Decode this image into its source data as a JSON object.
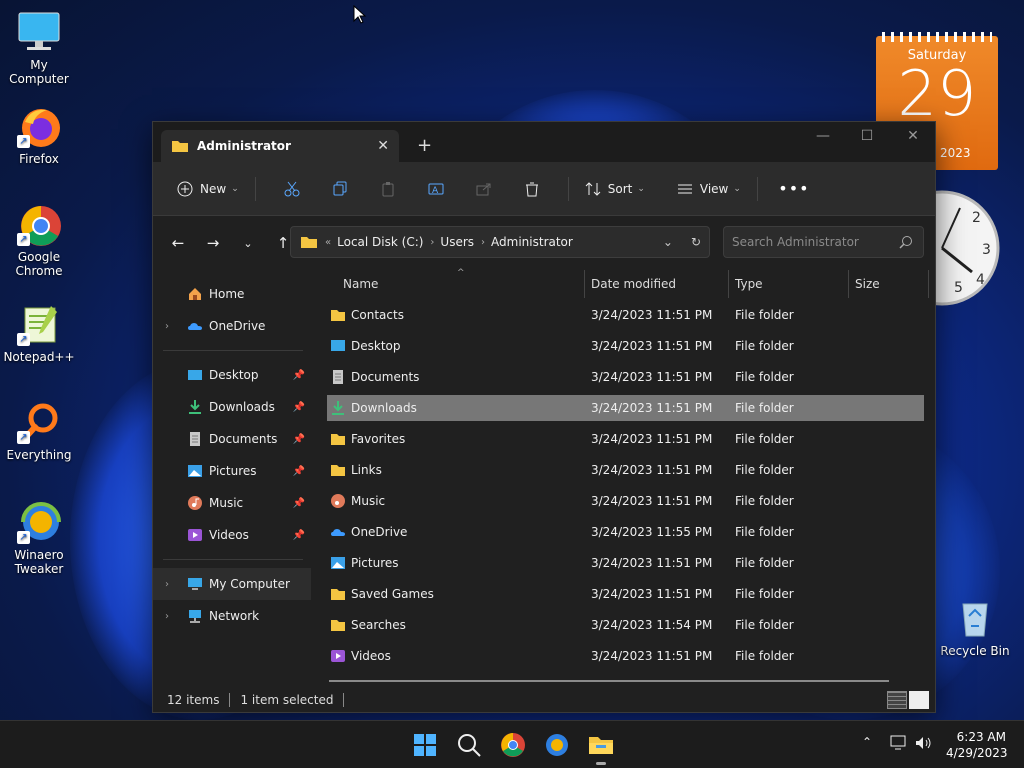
{
  "desktop": {
    "icons": [
      {
        "label": "My Computer"
      },
      {
        "label": "Firefox"
      },
      {
        "label": "Google Chrome"
      },
      {
        "label": "Notepad++"
      },
      {
        "label": "Everything"
      },
      {
        "label": "Winaero Tweaker"
      },
      {
        "label": "Recycle Bin"
      }
    ],
    "calendar": {
      "weekday": "Saturday",
      "day": "29",
      "year": "2023"
    }
  },
  "window": {
    "tab_title": "Administrator",
    "toolbar": {
      "new_label": "New",
      "sort_label": "Sort",
      "view_label": "View"
    },
    "address": {
      "crumbs": [
        "Local Disk (C:)",
        "Users",
        "Administrator"
      ]
    },
    "search": {
      "placeholder": "Search Administrator"
    },
    "sidebar": {
      "top": [
        {
          "label": "Home"
        },
        {
          "label": "OneDrive"
        }
      ],
      "quick": [
        {
          "label": "Desktop"
        },
        {
          "label": "Downloads"
        },
        {
          "label": "Documents"
        },
        {
          "label": "Pictures"
        },
        {
          "label": "Music"
        },
        {
          "label": "Videos"
        }
      ],
      "bottom": [
        {
          "label": "My Computer"
        },
        {
          "label": "Network"
        }
      ]
    },
    "columns": {
      "name": "Name",
      "date": "Date modified",
      "type": "Type",
      "size": "Size"
    },
    "rows": [
      {
        "name": "Contacts",
        "date": "3/24/2023 11:51 PM",
        "type": "File folder"
      },
      {
        "name": "Desktop",
        "date": "3/24/2023 11:51 PM",
        "type": "File folder"
      },
      {
        "name": "Documents",
        "date": "3/24/2023 11:51 PM",
        "type": "File folder"
      },
      {
        "name": "Downloads",
        "date": "3/24/2023 11:51 PM",
        "type": "File folder"
      },
      {
        "name": "Favorites",
        "date": "3/24/2023 11:51 PM",
        "type": "File folder"
      },
      {
        "name": "Links",
        "date": "3/24/2023 11:51 PM",
        "type": "File folder"
      },
      {
        "name": "Music",
        "date": "3/24/2023 11:51 PM",
        "type": "File folder"
      },
      {
        "name": "OneDrive",
        "date": "3/24/2023 11:55 PM",
        "type": "File folder"
      },
      {
        "name": "Pictures",
        "date": "3/24/2023 11:51 PM",
        "type": "File folder"
      },
      {
        "name": "Saved Games",
        "date": "3/24/2023 11:51 PM",
        "type": "File folder"
      },
      {
        "name": "Searches",
        "date": "3/24/2023 11:54 PM",
        "type": "File folder"
      },
      {
        "name": "Videos",
        "date": "3/24/2023 11:51 PM",
        "type": "File folder"
      }
    ],
    "status": {
      "items": "12 items",
      "selected": "1 item selected"
    }
  },
  "taskbar": {
    "time": "6:23 AM",
    "date": "4/29/2023"
  },
  "colors": {
    "accent": "#4fa3ff",
    "folder": "#f4c542",
    "selection": "#777777"
  }
}
